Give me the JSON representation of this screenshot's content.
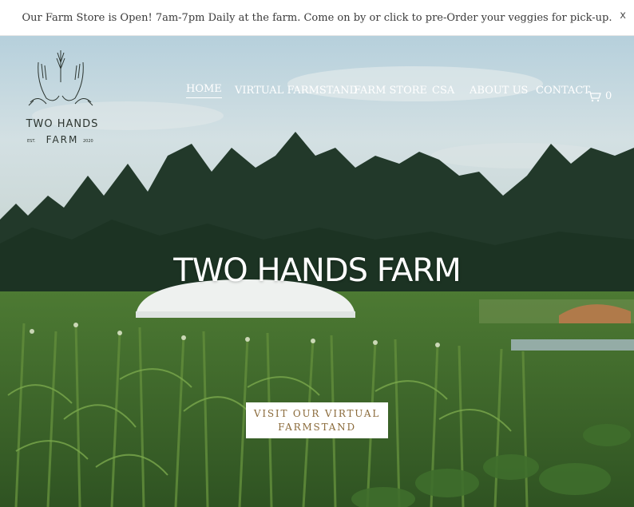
{
  "announcement": {
    "text": "Our Farm Store is Open! 7am-7pm Daily at the farm. Come on by or click to pre-Order your veggies for pick-up.",
    "close_label": "x"
  },
  "logo": {
    "title": "TWO HANDS",
    "subtitle": "FARM",
    "est": "EST.",
    "year": "2020"
  },
  "nav": {
    "items": [
      {
        "label": "HOME",
        "active": true
      },
      {
        "label": "VIRTUAL FARMSTAND",
        "active": false
      },
      {
        "label": "FARM STORE",
        "active": false
      },
      {
        "label": "CSA",
        "active": false
      },
      {
        "label": "ABOUT US",
        "active": false
      },
      {
        "label": "CONTACT",
        "active": false
      }
    ],
    "cart_count": "0"
  },
  "hero": {
    "title": "TWO HANDS FARM",
    "cta_label": "VISIT OUR VIRTUAL FARMSTAND"
  },
  "colors": {
    "accent": "#8a6a3a",
    "nav_text": "#ffffff"
  }
}
